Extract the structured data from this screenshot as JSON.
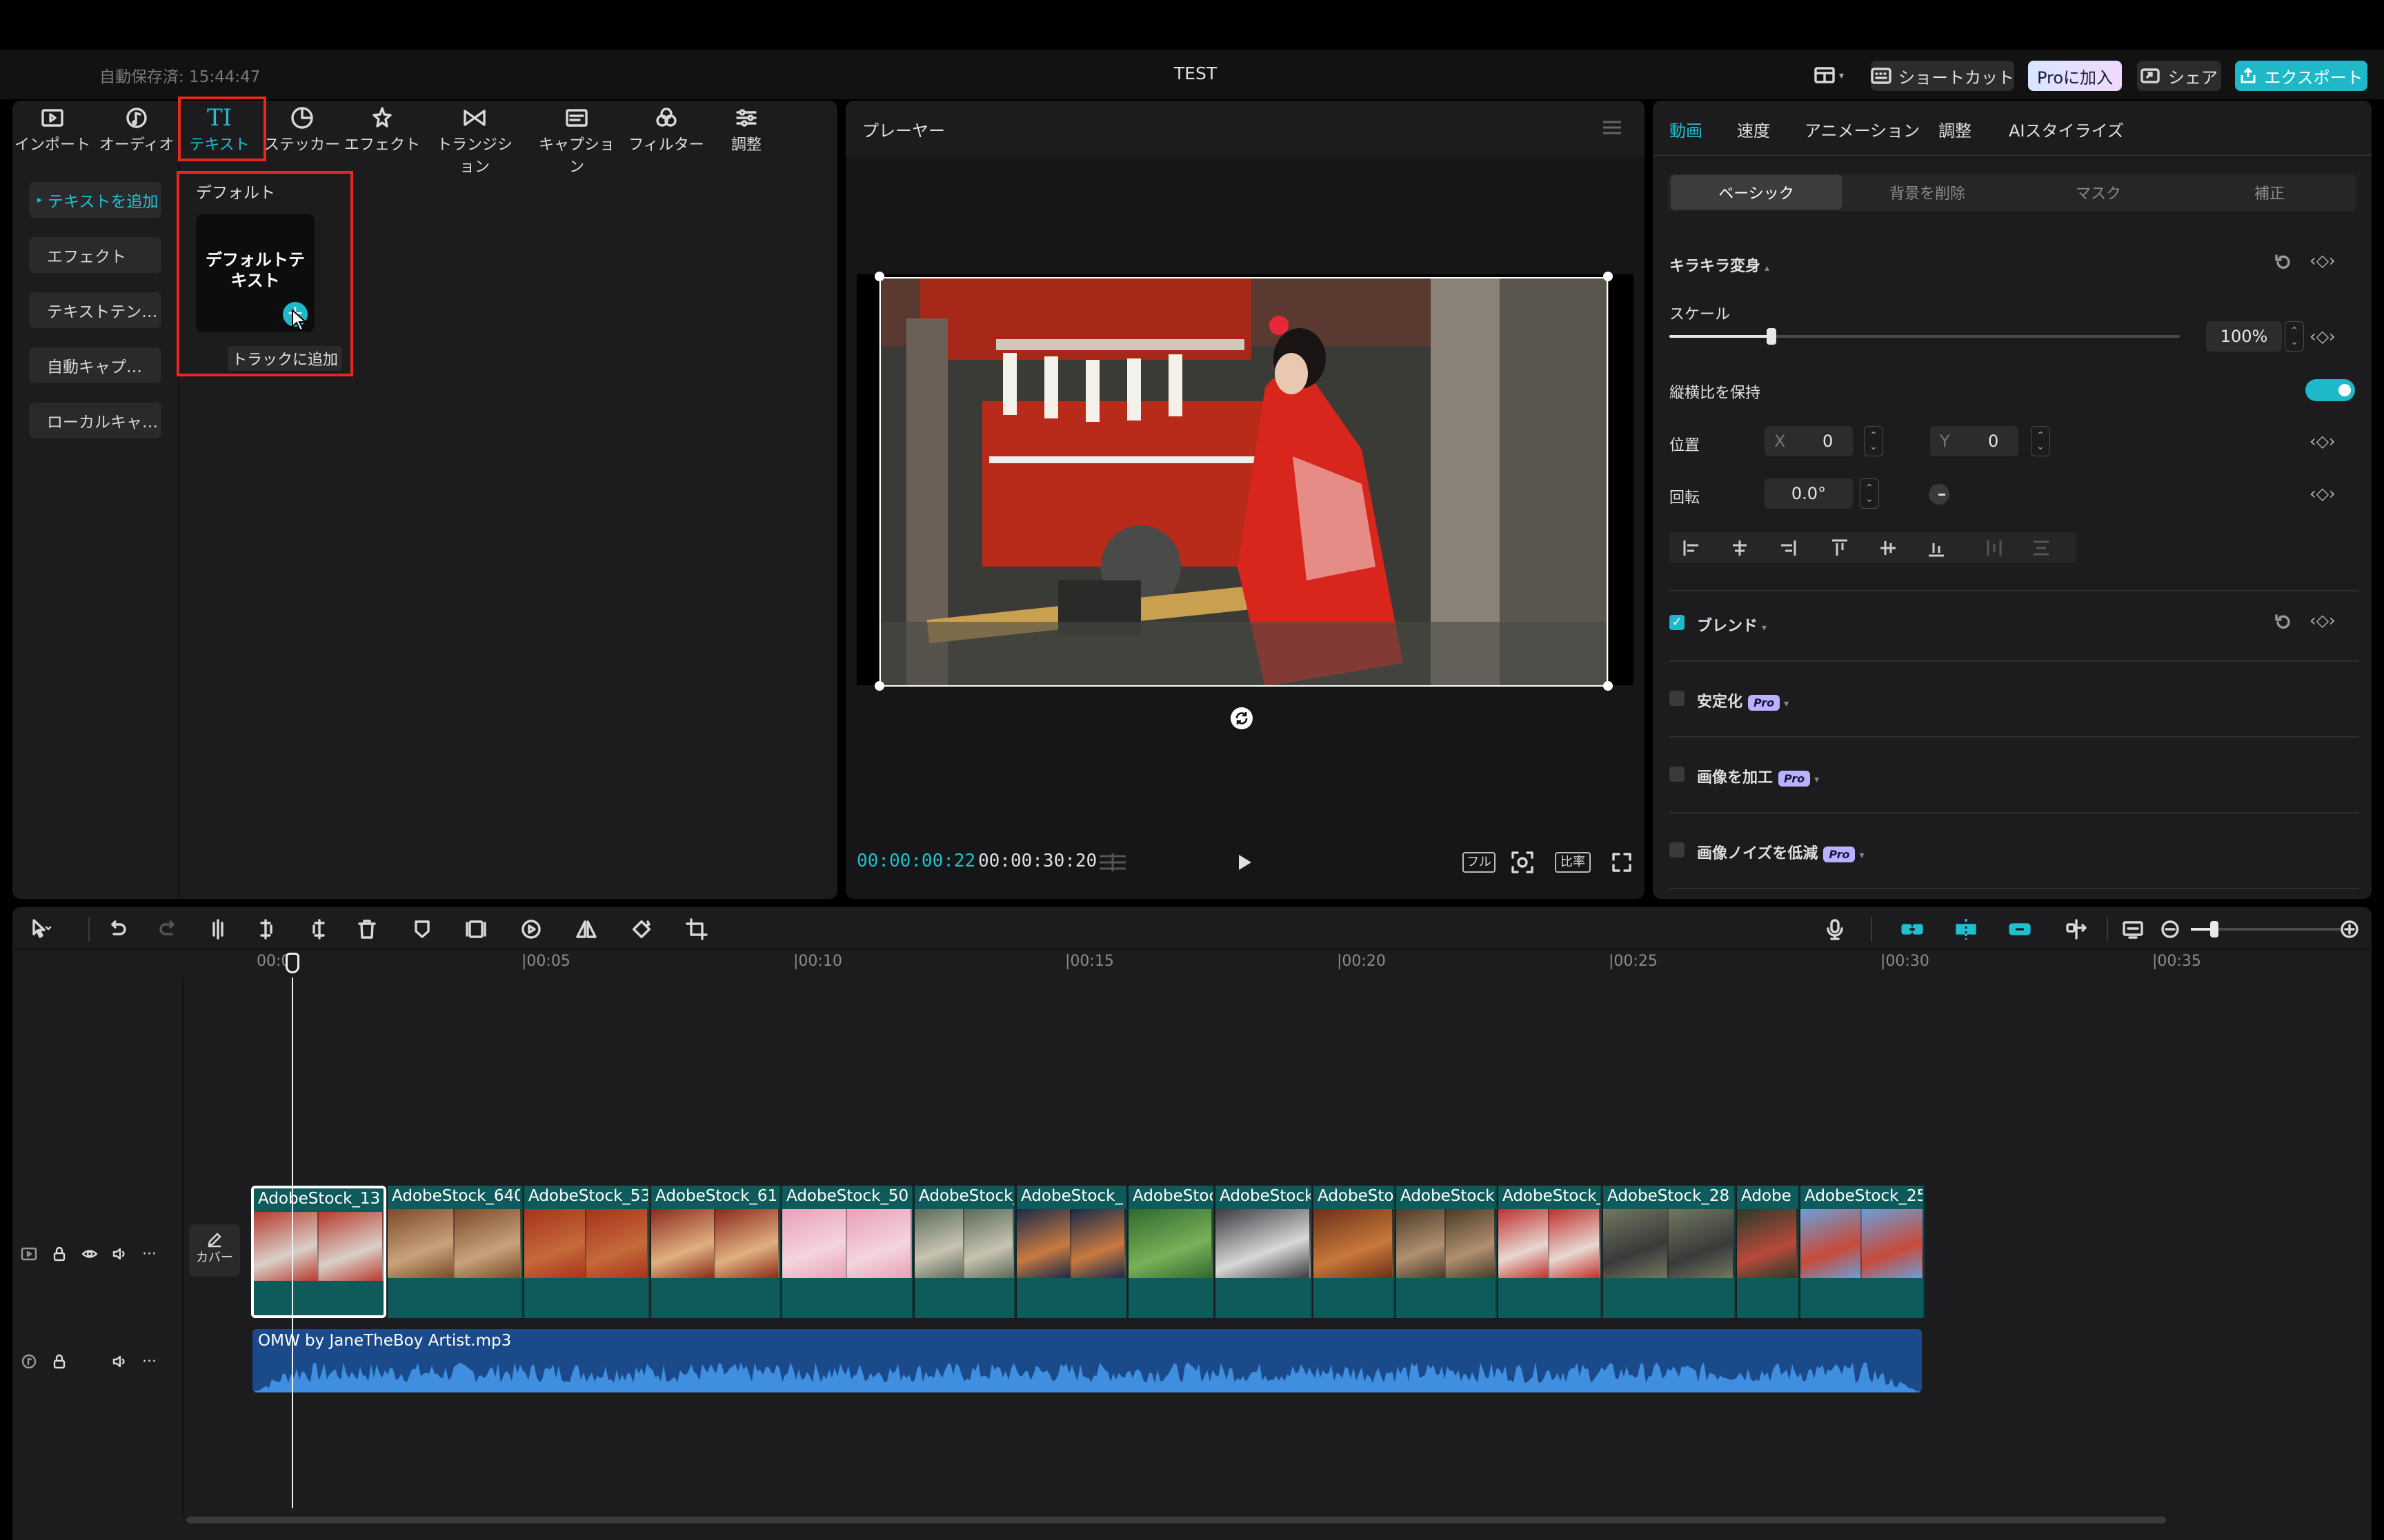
{
  "header": {
    "autosave": "自動保存済: 15:44:47",
    "project_title": "TEST",
    "shortcut_label": "ショートカット",
    "pro_label": "Proに加入",
    "share_label": "シェア",
    "export_label": "エクスポート"
  },
  "media_toolbar": {
    "items": [
      {
        "label": "インポート",
        "icon": "import-icon"
      },
      {
        "label": "オーディオ",
        "icon": "audio-icon"
      },
      {
        "label": "テキスト",
        "icon": "text-icon",
        "active": true
      },
      {
        "label": "ステッカー",
        "icon": "sticker-icon"
      },
      {
        "label": "エフェクト",
        "icon": "effect-icon"
      },
      {
        "label": "トランジション",
        "icon": "transition-icon"
      },
      {
        "label": "キャプション",
        "icon": "caption-icon"
      },
      {
        "label": "フィルター",
        "icon": "filter-icon"
      },
      {
        "label": "調整",
        "icon": "adjust-icon"
      }
    ]
  },
  "text_sidebar": {
    "items": [
      "テキストを追加",
      "エフェクト",
      "テキストテン…",
      "自動キャプ…",
      "ローカルキャ…"
    ]
  },
  "text_panel": {
    "section_title": "デフォルト",
    "card_label": "デフォルトテキスト",
    "add_tooltip": "トラックに追加"
  },
  "player": {
    "title": "プレーヤー",
    "current_time": "00:00:00:22",
    "total_time": "00:00:30:20",
    "full_label": "フル",
    "ratio_label": "比率"
  },
  "inspector": {
    "tabs": [
      "動画",
      "速度",
      "アニメーション",
      "調整",
      "AIスタイライズ"
    ],
    "subtabs": [
      "ベーシック",
      "背景を削除",
      "マスク",
      "補正"
    ],
    "transform_title": "キラキラ変身",
    "scale_label": "スケール",
    "scale_value": "100%",
    "scale_fraction": 0.2,
    "keep_ratio_label": "縦横比を保持",
    "keep_ratio_on": true,
    "position_label": "位置",
    "x_label": "X",
    "x_value": "0",
    "y_label": "Y",
    "y_value": "0",
    "rotation_label": "回転",
    "rotation_value": "0.0°",
    "blend_label": "ブレンド",
    "blend_checked": true,
    "stabilize_label": "安定化",
    "enhance_label": "画像を加工",
    "denoise_label": "画像ノイズを低減",
    "pro_badge": "Pro"
  },
  "timeline": {
    "ruler": [
      "00:00",
      "|00:05",
      "|00:10",
      "|00:15",
      "|00:20",
      "|00:25",
      "|00:30",
      "|00:35"
    ],
    "cover_label": "カバー",
    "clips": [
      {
        "name": "AdobeStock_13",
        "colors": [
          "#b83a2e",
          "#d9d0c8"
        ]
      },
      {
        "name": "AdobeStock_640",
        "colors": [
          "#7a4a2a",
          "#c9a27a"
        ]
      },
      {
        "name": "AdobeStock_53",
        "colors": [
          "#a8321e",
          "#c46a3a"
        ]
      },
      {
        "name": "AdobeStock_61",
        "colors": [
          "#8a2a1c",
          "#e0b080"
        ]
      },
      {
        "name": "AdobeStock_50",
        "colors": [
          "#e8a0b8",
          "#f4d4e0"
        ]
      },
      {
        "name": "AdobeStock_",
        "colors": [
          "#5a6a5a",
          "#c8c4b0"
        ]
      },
      {
        "name": "AdobeStock_",
        "colors": [
          "#1a2a4a",
          "#c87a40"
        ]
      },
      {
        "name": "AdobeStock",
        "colors": [
          "#2e6a2e",
          "#7ab05a"
        ]
      },
      {
        "name": "AdobeStock",
        "colors": [
          "#3a3a40",
          "#d8d8d8"
        ]
      },
      {
        "name": "AdobeStock",
        "colors": [
          "#6a3018",
          "#c8783a"
        ]
      },
      {
        "name": "AdobeStock",
        "colors": [
          "#4a3a28",
          "#b09070"
        ]
      },
      {
        "name": "AdobeStock_",
        "colors": [
          "#c03030",
          "#e8d8d0"
        ]
      },
      {
        "name": "AdobeStock_28",
        "colors": [
          "#707860",
          "#3a3a3a"
        ]
      },
      {
        "name": "Adobe",
        "colors": [
          "#2a3a2a",
          "#b84a3a"
        ]
      },
      {
        "name": "AdobeStock_25",
        "colors": [
          "#6aa0d8",
          "#c84a3a"
        ]
      }
    ],
    "audio_name": "OMW by JaneTheBoy Artist.mp3"
  }
}
